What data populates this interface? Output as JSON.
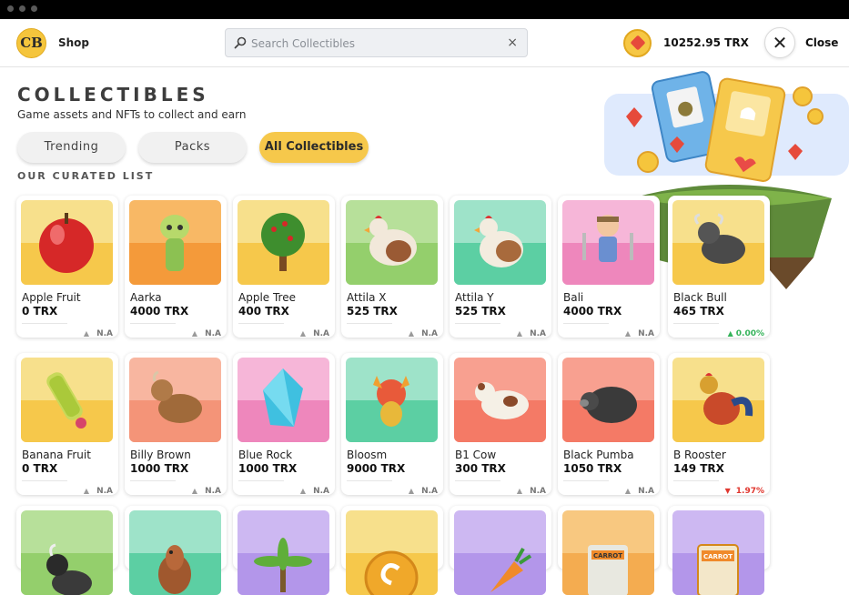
{
  "header": {
    "logo_text": "CB",
    "shop_label": "Shop",
    "search_placeholder": "Search Collectibles",
    "clear_icon": "×",
    "balance": "10252.95 TRX",
    "close_label": "Close",
    "close_icon": "✕"
  },
  "page": {
    "title": "COLLECTIBLES",
    "subtitle": "Game assets and NFTs to collect and earn",
    "section_label": "OUR CURATED LIST"
  },
  "tabs": [
    {
      "label": "Trending"
    },
    {
      "label": "Packs"
    },
    {
      "label": "All Collectibles"
    }
  ],
  "colors": {
    "accent": "#f6c84b",
    "up": "#35b35a",
    "down": "#e0372f"
  },
  "cards": [
    {
      "name": "Apple Fruit",
      "price": "0 TRX",
      "change": "N.A",
      "icon": "red-apple",
      "bg": [
        "#f7e08c",
        "#f6c84b"
      ]
    },
    {
      "name": "Aarka",
      "price": "4000 TRX",
      "change": "N.A",
      "icon": "forest-fairy",
      "bg": [
        "#f8b865",
        "#f49a3a"
      ]
    },
    {
      "name": "Apple Tree",
      "price": "400 TRX",
      "change": "N.A",
      "icon": "apple-tree",
      "bg": [
        "#f7e08c",
        "#f6c84b"
      ]
    },
    {
      "name": "Attila X",
      "price": "525 TRX",
      "change": "N.A",
      "icon": "brown-hen",
      "bg": [
        "#b7e09a",
        "#94cf6c"
      ]
    },
    {
      "name": "Attila Y",
      "price": "525 TRX",
      "change": "N.A",
      "icon": "rooster",
      "bg": [
        "#9ee3c9",
        "#5ccfa3"
      ]
    },
    {
      "name": "Bali",
      "price": "4000 TRX",
      "change": "N.A",
      "icon": "viking-warrior",
      "bg": [
        "#f6b6d8",
        "#ee87bc"
      ]
    },
    {
      "name": "Black Bull",
      "price": "465 TRX",
      "change": "0.00%",
      "direction": "up",
      "icon": "black-bull",
      "bg": [
        "#f7e08c",
        "#f6c84b"
      ]
    },
    {
      "name": "Banana Fruit",
      "price": "0 TRX",
      "change": "N.A",
      "icon": "banana-bunch",
      "bg": [
        "#f7e08c",
        "#f6c84b"
      ]
    },
    {
      "name": "Billy Brown",
      "price": "1000 TRX",
      "change": "N.A",
      "icon": "brown-goat",
      "bg": [
        "#f8b6a0",
        "#f49478"
      ]
    },
    {
      "name": "Blue Rock",
      "price": "1000 TRX",
      "change": "N.A",
      "icon": "blue-crystal",
      "bg": [
        "#f6b6d8",
        "#ee87bc"
      ]
    },
    {
      "name": "Bloosm",
      "price": "9000 TRX",
      "change": "N.A",
      "icon": "fire-creature",
      "bg": [
        "#9ee3c9",
        "#5ccfa3"
      ]
    },
    {
      "name": "B1 Cow",
      "price": "300 TRX",
      "change": "N.A",
      "icon": "spotted-cow",
      "bg": [
        "#f8a090",
        "#f47a66"
      ]
    },
    {
      "name": "Black Pumba",
      "price": "1050 TRX",
      "change": "N.A",
      "icon": "black-pig",
      "bg": [
        "#f8a090",
        "#f47a66"
      ]
    },
    {
      "name": "B Rooster",
      "price": "149 TRX",
      "change": "1.97%",
      "direction": "down",
      "icon": "colorful-rooster",
      "bg": [
        "#f7e08c",
        "#f6c84b"
      ]
    },
    {
      "name": "",
      "price": "",
      "change": "",
      "icon": "black-goat",
      "bg": [
        "#b7e09a",
        "#94cf6c"
      ]
    },
    {
      "name": "",
      "price": "",
      "change": "",
      "icon": "horse",
      "bg": [
        "#9ee3c9",
        "#5ccfa3"
      ]
    },
    {
      "name": "",
      "price": "",
      "change": "",
      "icon": "palm-plant",
      "bg": [
        "#cdb8f2",
        "#b396ea"
      ]
    },
    {
      "name": "",
      "price": "",
      "change": "",
      "icon": "gold-coin",
      "bg": [
        "#f7e08c",
        "#f6c84b"
      ]
    },
    {
      "name": "",
      "price": "",
      "change": "",
      "icon": "carrot",
      "bg": [
        "#cdb8f2",
        "#b396ea"
      ]
    },
    {
      "name": "",
      "price": "",
      "change": "",
      "icon": "carrot-seed-bag",
      "bg": [
        "#f8c880",
        "#f4ac50"
      ]
    },
    {
      "name": "",
      "price": "",
      "change": "",
      "icon": "carrot-seed-pack",
      "bg": [
        "#cdb8f2",
        "#b396ea"
      ]
    }
  ]
}
